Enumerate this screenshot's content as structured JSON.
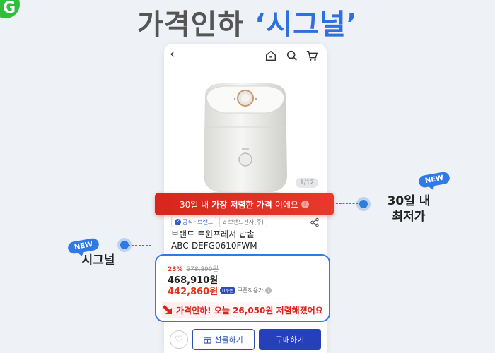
{
  "logo": {
    "letter": "G"
  },
  "headline": {
    "prefix": "가격인하 ",
    "accent": "‘시그널’"
  },
  "app": {
    "image_counter": "1/12",
    "badges": {
      "official": "공식",
      "brand": "브랜드",
      "seller": "브랜드전자(주)"
    },
    "product_name_line1": "브랜드 트윈프레셔 밥솥",
    "product_name_line2": "ABC-DEFG0610FWM",
    "buttons": {
      "gift": "선물하기",
      "buy": "구매하기"
    }
  },
  "banner": {
    "prefix": "30일 내 ",
    "bold": "가장 저렴한 가격",
    "suffix": "이에요",
    "info_mark": "i"
  },
  "price": {
    "discount_rate": "23%",
    "original_price": "578,890원",
    "sale_price": "468,910원",
    "coupon_price": "442,860원",
    "coupon_tag": "U쿠폰",
    "coupon_label": "쿠폰적용가",
    "info_mark": "i",
    "drop_message": "가격인하! 오늘 26,050원 저렴해졌어요"
  },
  "callouts": {
    "right_badge": "NEW",
    "right_line1": "30일 내",
    "right_line2": "최저가",
    "left_badge": "NEW",
    "left_label": "시그널"
  },
  "colors": {
    "accent_blue": "#2f7ae6",
    "banner_red": "#d9251c",
    "buy_button": "#2540b8",
    "logo_green": "#2fbf3a"
  },
  "icons": [
    "back-icon",
    "home-icon",
    "search-icon",
    "cart-icon",
    "share-icon",
    "heart-icon",
    "gift-icon",
    "down-arrow-icon",
    "info-icon",
    "check-icon"
  ]
}
